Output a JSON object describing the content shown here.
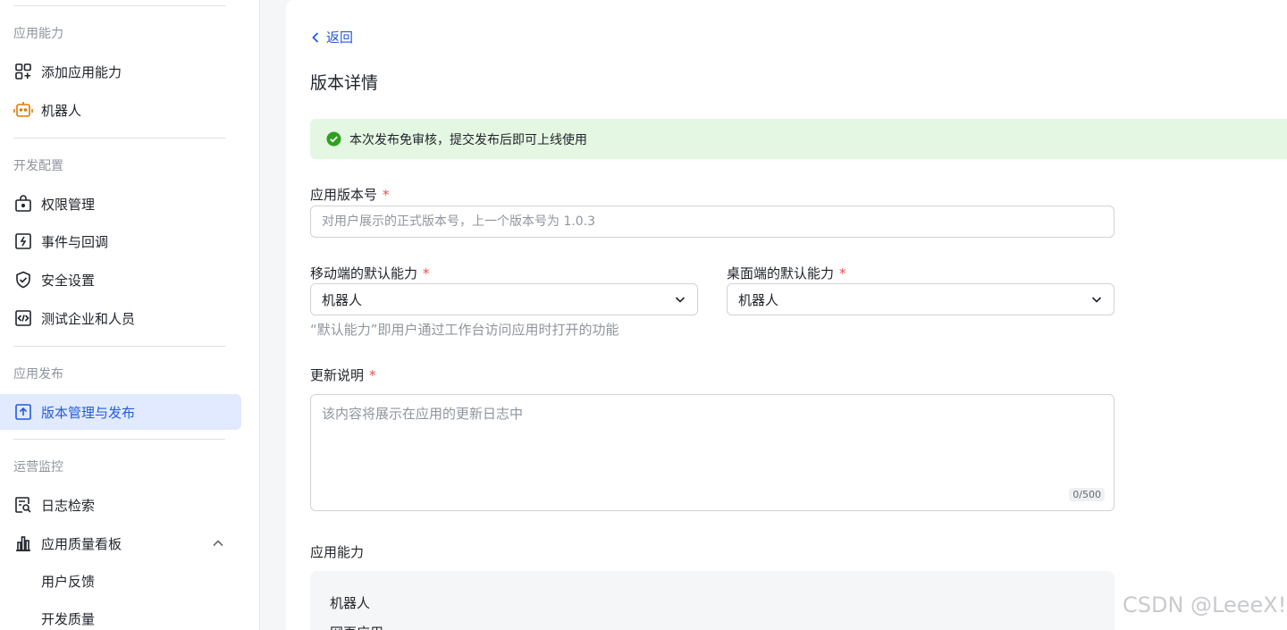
{
  "sidebar": {
    "sections": [
      {
        "title": "应用能力"
      },
      {
        "title": "开发配置"
      },
      {
        "title": "应用发布"
      },
      {
        "title": "运营监控"
      }
    ],
    "items": [
      {
        "label": "添加应用能力",
        "icon": "add-app-icon"
      },
      {
        "label": "机器人",
        "icon": "robot-icon"
      },
      {
        "label": "权限管理",
        "icon": "lock-icon"
      },
      {
        "label": "事件与回调",
        "icon": "event-icon"
      },
      {
        "label": "安全设置",
        "icon": "shield-icon"
      },
      {
        "label": "测试企业和人员",
        "icon": "code-icon"
      },
      {
        "label": "版本管理与发布",
        "icon": "upload-icon",
        "active": true
      },
      {
        "label": "日志检索",
        "icon": "log-search-icon"
      },
      {
        "label": "应用质量看板",
        "icon": "bar-chart-icon"
      }
    ],
    "subitems": [
      {
        "label": "用户反馈"
      },
      {
        "label": "开发质量"
      }
    ]
  },
  "main": {
    "back_label": "返回",
    "page_title": "版本详情",
    "notice": "本次发布免审核，提交发布后即可上线使用",
    "version": {
      "label": "应用版本号",
      "required_mark": "*",
      "placeholder": "对用户展示的正式版本号，上一个版本号为 1.0.3",
      "value": ""
    },
    "mobile_default": {
      "label": "移动端的默认能力",
      "required_mark": "*",
      "value": "机器人"
    },
    "desktop_default": {
      "label": "桌面端的默认能力",
      "required_mark": "*",
      "value": "机器人"
    },
    "default_hint": "“默认能力”即用户通过工作台访问应用时打开的功能",
    "update_notes": {
      "label": "更新说明",
      "required_mark": "*",
      "placeholder": "该内容将展示在应用的更新日志中",
      "counter": "0/500"
    },
    "capabilities": {
      "label": "应用能力",
      "items": [
        "机器人",
        "网页应用"
      ]
    }
  },
  "watermark": "CSDN @LeeeX!",
  "colors": {
    "accent": "#245bdb",
    "active_bg": "#e1eaff",
    "success_bg": "#e4f7e2",
    "success": "#2ea121",
    "required": "#f54a45",
    "robot_icon": "#de7802"
  }
}
